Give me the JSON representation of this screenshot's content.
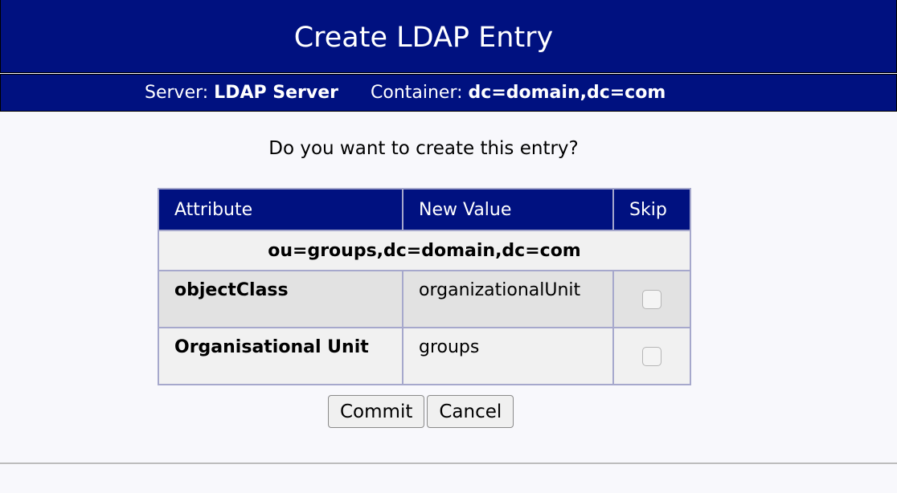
{
  "header": {
    "title": "Create LDAP Entry"
  },
  "info": {
    "server_label": "Server:",
    "server_value": "LDAP Server",
    "container_label": "Container:",
    "container_value": "dc=domain,dc=com"
  },
  "prompt": "Do you want to create this entry?",
  "table": {
    "columns": [
      "Attribute",
      "New Value",
      "Skip"
    ],
    "dn": "ou=groups,dc=domain,dc=com",
    "rows": [
      {
        "attribute": "objectClass",
        "value": "organizationalUnit",
        "skip": false
      },
      {
        "attribute": "Organisational Unit",
        "value": "groups",
        "skip": false
      }
    ]
  },
  "actions": {
    "commit_label": "Commit",
    "cancel_label": "Cancel"
  },
  "colors": {
    "header_bg": "#001180",
    "row_alt": "#e2e2e2",
    "row_light": "#f1f1f1",
    "border": "#a6a8cc"
  }
}
